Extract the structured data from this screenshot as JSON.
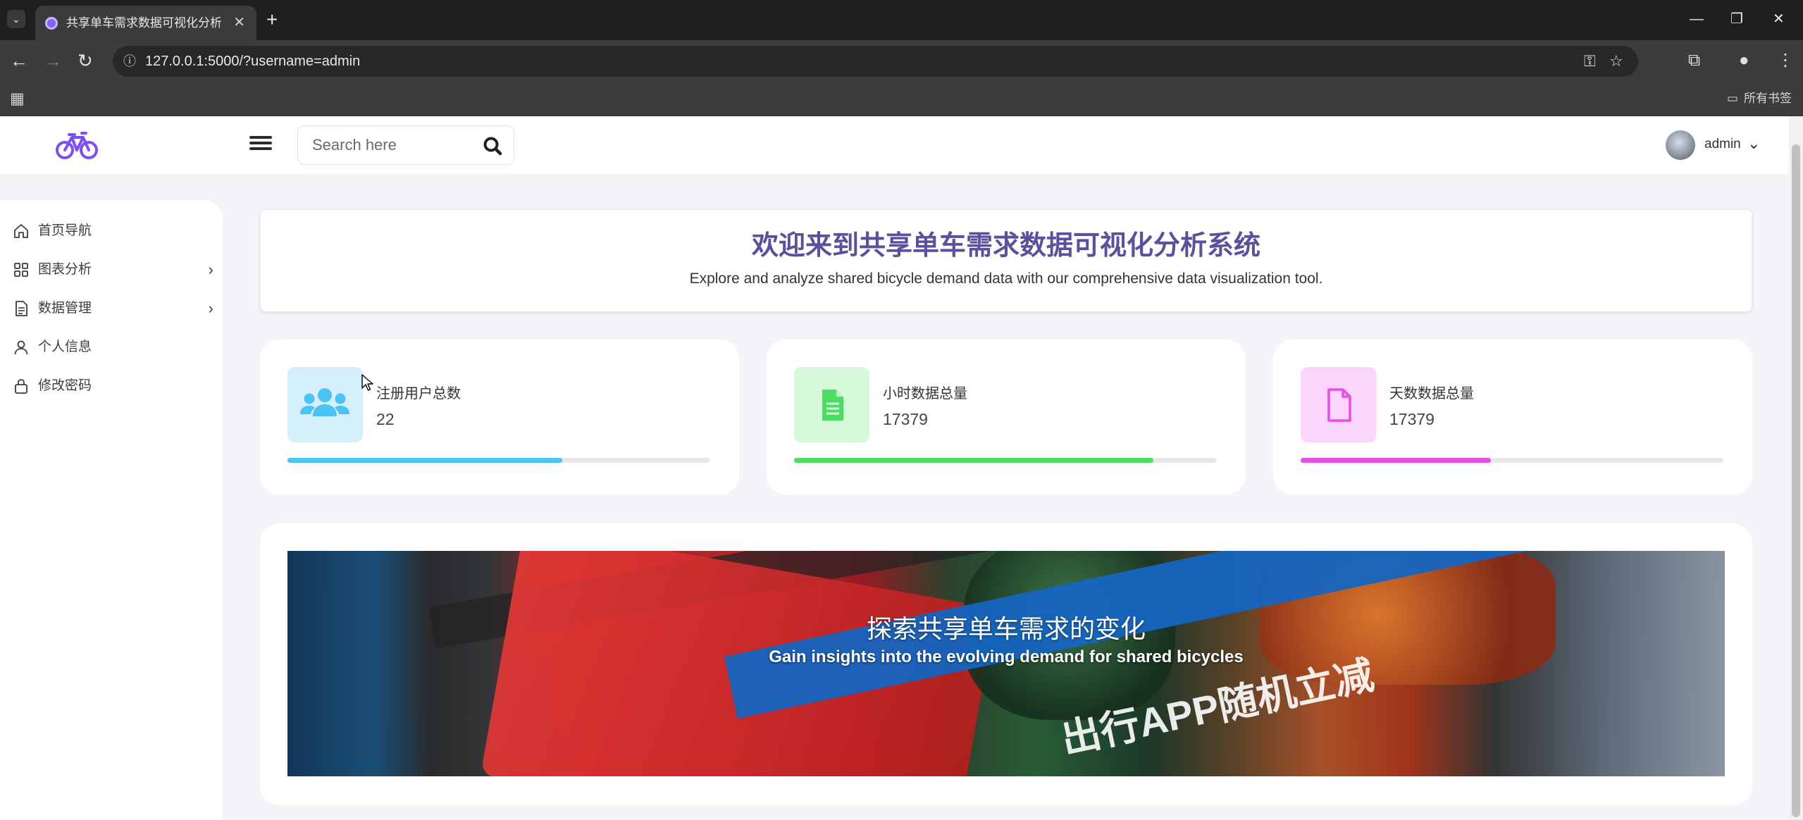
{
  "browser": {
    "tab_title": "共享单车需求数据可视化分析系",
    "tab_close": "✕",
    "new_tab": "+",
    "url": "127.0.0.1:5000/?username=admin",
    "all_bookmarks": "所有书签",
    "window_controls": {
      "minimize": "—",
      "restore": "❐",
      "close": "✕"
    }
  },
  "header": {
    "search_placeholder": "Search here",
    "user_name": "admin"
  },
  "sidebar": {
    "items": [
      {
        "label": "首页导航",
        "icon": "home-icon",
        "has_submenu": false
      },
      {
        "label": "图表分析",
        "icon": "grid-icon",
        "has_submenu": true
      },
      {
        "label": "数据管理",
        "icon": "document-icon",
        "has_submenu": true
      },
      {
        "label": "个人信息",
        "icon": "user-icon",
        "has_submenu": false
      },
      {
        "label": "修改密码",
        "icon": "lock-icon",
        "has_submenu": false
      }
    ]
  },
  "welcome": {
    "title": "欢迎来到共享单车需求数据可视化分析系统",
    "subtitle": "Explore and analyze shared bicycle demand data with our comprehensive data visualization tool."
  },
  "stats": [
    {
      "label": "注册用户总数",
      "value": "22",
      "icon": "users-icon",
      "color": "#4cc3f5",
      "icon_bg": "#d4f0fd",
      "progress": 0.65
    },
    {
      "label": "小时数据总量",
      "value": "17379",
      "icon": "file-text-icon",
      "color": "#4cde63",
      "icon_bg": "#d6f9dc",
      "progress": 0.85
    },
    {
      "label": "天数数据总量",
      "value": "17379",
      "icon": "file-icon",
      "color": "#e84ce8",
      "icon_bg": "#fbd5fb",
      "progress": 0.45
    }
  ],
  "banner": {
    "title": "探索共享单车需求的变化",
    "subtitle": "Gain insights into the evolving demand for shared bicycles",
    "photo_text": "出行APP随机立减"
  },
  "colors": {
    "accent": "#7c4dff",
    "title": "#5b4f9e"
  }
}
